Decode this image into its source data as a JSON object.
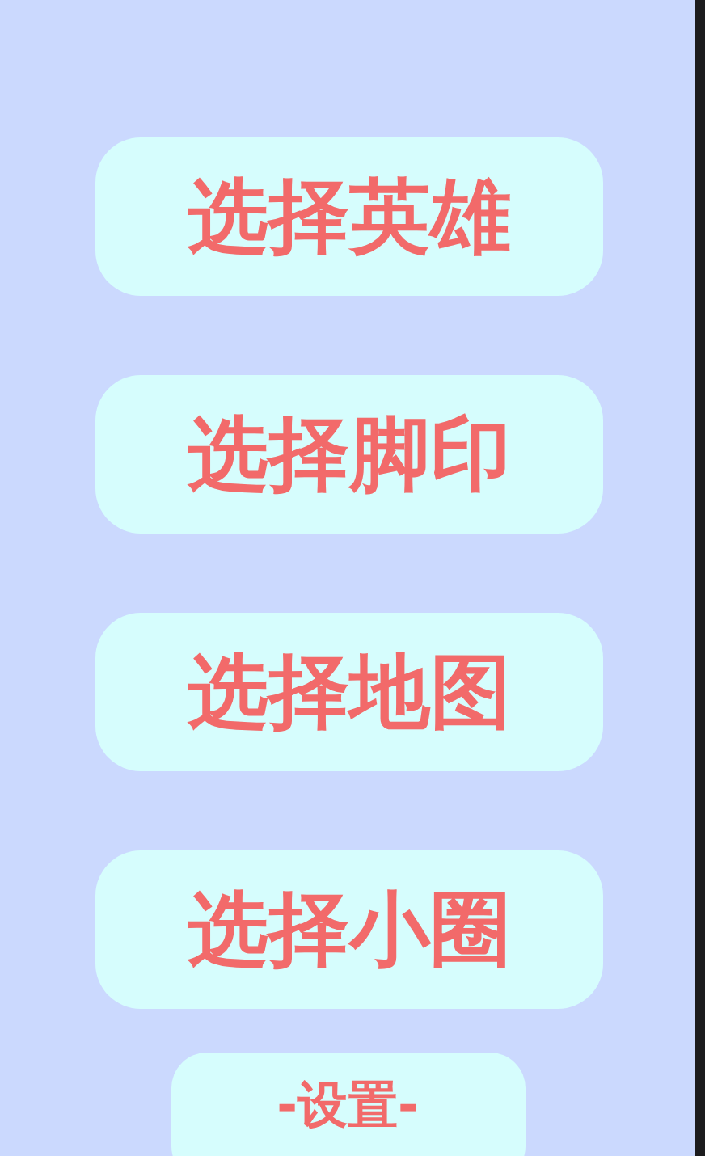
{
  "menu_buttons": [
    {
      "label": "选择英雄"
    },
    {
      "label": "选择脚印"
    },
    {
      "label": "选择地图"
    },
    {
      "label": "选择小圈"
    }
  ],
  "settings_button": {
    "label": "-设置-"
  }
}
